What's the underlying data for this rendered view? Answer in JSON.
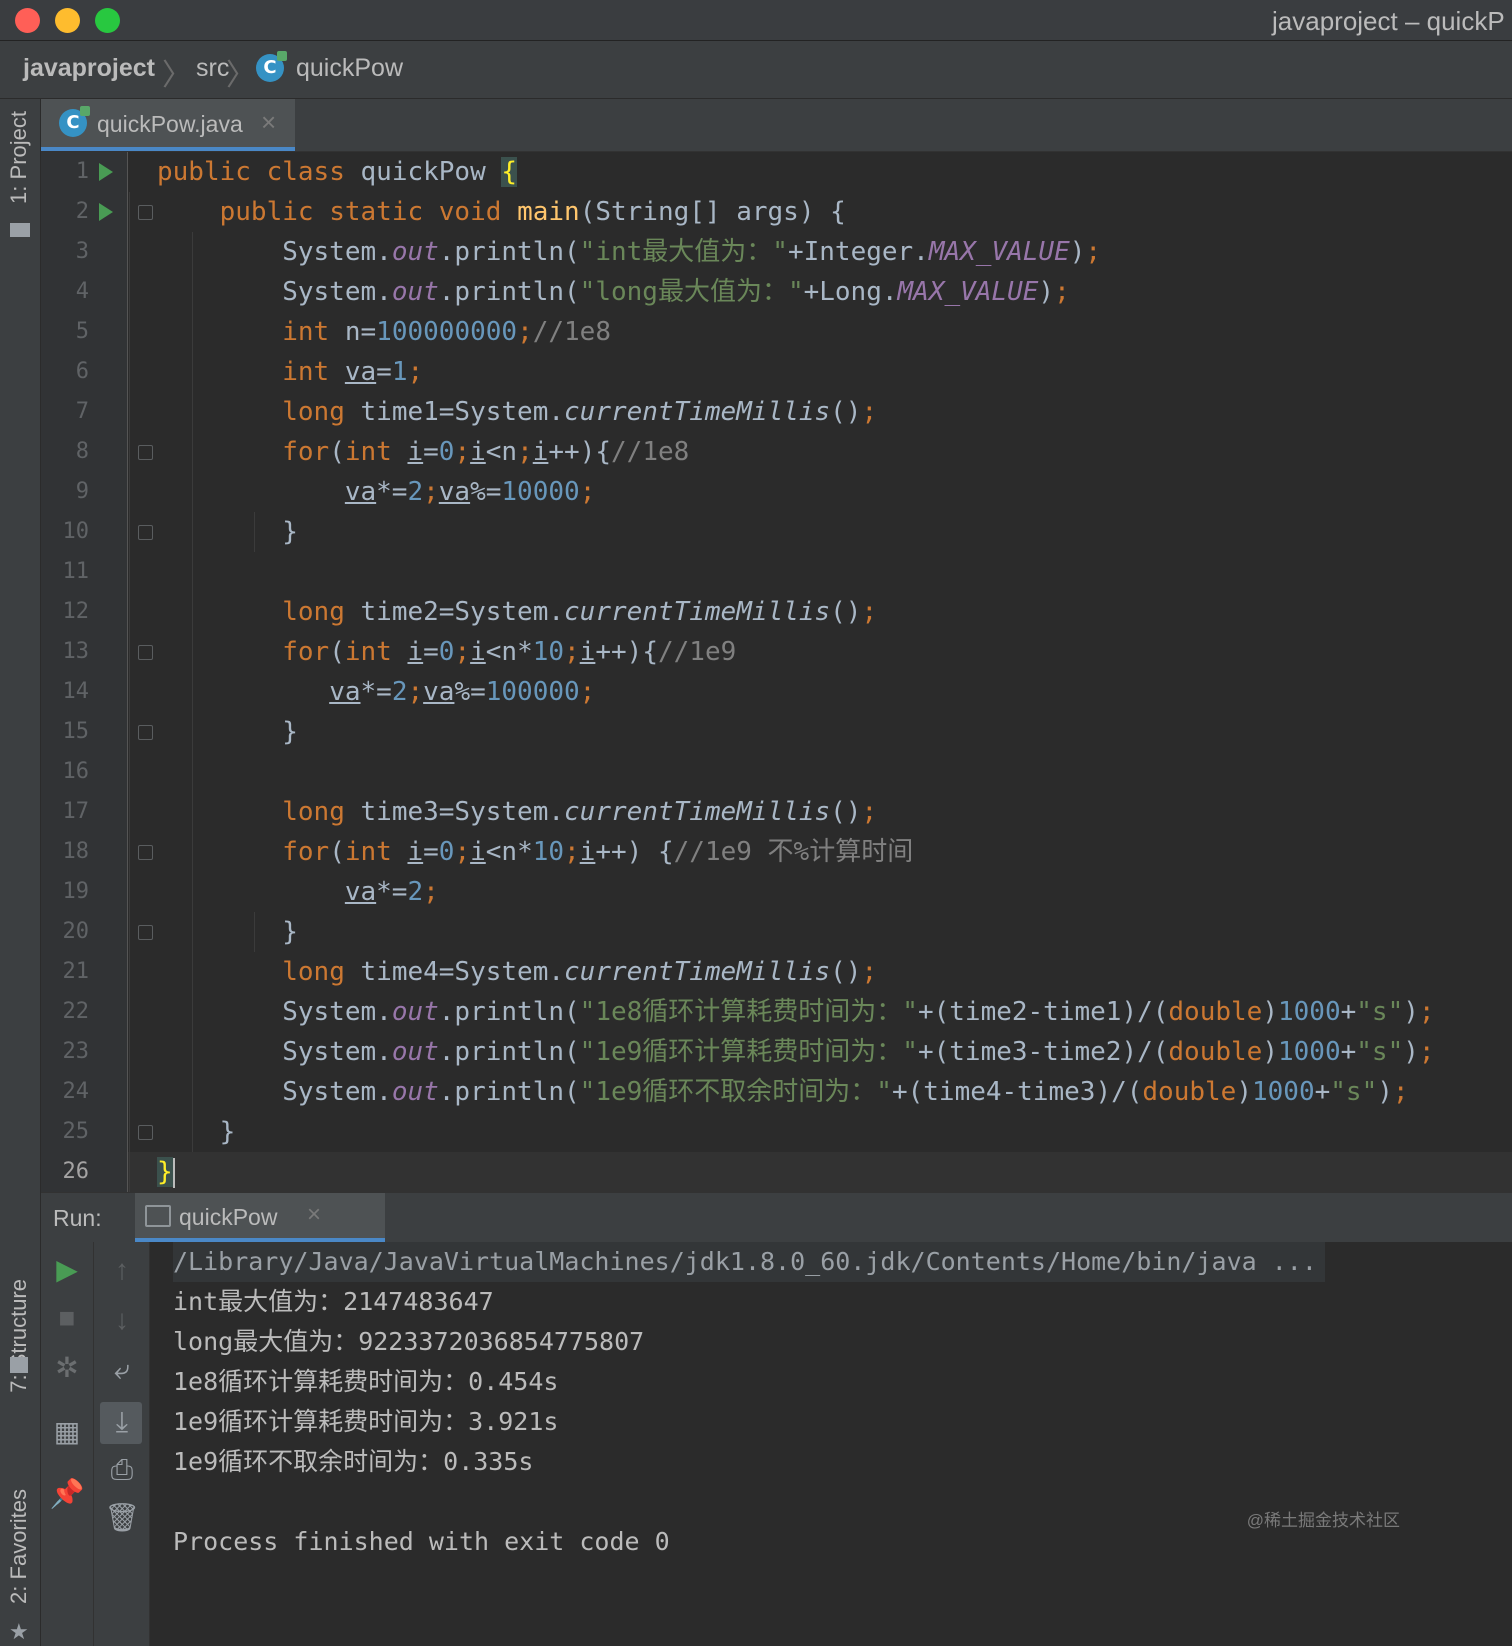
{
  "window": {
    "title": "javaproject – quickP"
  },
  "breadcrumb": {
    "project": "javaproject",
    "folder": "src",
    "file": "quickPow"
  },
  "tool_windows": {
    "project": "1: Project",
    "structure": "7: Structure",
    "favorites": "2: Favorites"
  },
  "editor": {
    "tab_label": "quickPow.java",
    "class_icon": "C",
    "current_line": 26
  },
  "code_lines": [
    "public class quickPow {",
    "    public static void main(String[] args) {",
    "        System.out.println(\"int最大值为：\"+Integer.MAX_VALUE);",
    "        System.out.println(\"long最大值为：\"+Long.MAX_VALUE);",
    "        int n=100000000;//1e8",
    "        int va=1;",
    "        long time1=System.currentTimeMillis();",
    "        for(int i=0;i<n;i++){//1e8",
    "            va*=2;va%=10000;",
    "        }",
    "",
    "        long time2=System.currentTimeMillis();",
    "        for(int i=0;i<n*10;i++){//1e9",
    "           va*=2;va%=100000;",
    "        }",
    "",
    "        long time3=System.currentTimeMillis();",
    "        for(int i=0;i<n*10;i++) {//1e9 不%计算时间",
    "            va*=2;",
    "        }",
    "        long time4=System.currentTimeMillis();",
    "        System.out.println(\"1e8循环计算耗费时间为：\"+(time2-time1)/(double)1000+\"s\");",
    "        System.out.println(\"1e9循环计算耗费时间为：\"+(time3-time2)/(double)1000+\"s\");",
    "        System.out.println(\"1e9循环不取余时间为：\"+(time4-time3)/(double)1000+\"s\");",
    "    }",
    "}"
  ],
  "run": {
    "label": "Run:",
    "tab_label": "quickPow",
    "output": [
      "/Library/Java/JavaVirtualMachines/jdk1.8.0_60.jdk/Contents/Home/bin/java ...",
      "int最大值为：2147483647",
      "long最大值为：9223372036854775807",
      "1e8循环计算耗费时间为：0.454s",
      "1e9循环计算耗费时间为：3.921s",
      "1e9循环不取余时间为：0.335s",
      "",
      "Process finished with exit code 0"
    ]
  },
  "watermark": "@稀土掘金技术社区",
  "colors": {
    "keyword": "#cc7832",
    "string": "#6a8759",
    "number": "#6897bb",
    "comment": "#808080",
    "field": "#9876aa",
    "method": "#ffc66d",
    "text": "#a9b7c6"
  },
  "icons": [
    "run-icon",
    "stop-icon",
    "rerun-icon",
    "up-arrow-icon",
    "down-arrow-icon",
    "soft-wrap-icon",
    "scroll-to-end-icon",
    "print-icon",
    "trash-icon",
    "pin-icon",
    "layout-icon",
    "close-icon",
    "class-icon",
    "console-icon",
    "folder-icon",
    "star-icon"
  ]
}
